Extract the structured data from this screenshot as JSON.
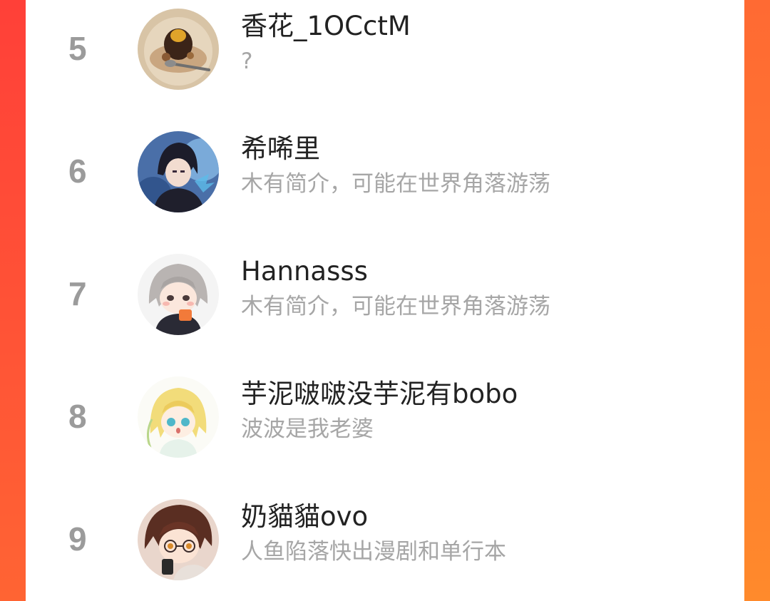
{
  "ranking": {
    "items": [
      {
        "rank": "5",
        "name": "香花_1OCctM",
        "bio": "?",
        "avatar_icon": "dessert-avatar"
      },
      {
        "rank": "6",
        "name": "希唏里",
        "bio": "木有简介，可能在世界角落游荡",
        "avatar_icon": "dark-haired-character-avatar"
      },
      {
        "rank": "7",
        "name": "Hannasss",
        "bio": "木有简介，可能在世界角落游荡",
        "avatar_icon": "chibi-silver-haired-avatar"
      },
      {
        "rank": "8",
        "name": "芋泥啵啵没芋泥有bobo",
        "bio": "波波是我老婆",
        "avatar_icon": "chibi-blonde-avatar"
      },
      {
        "rank": "9",
        "name": "奶貓貓ovo",
        "bio": "人鱼陷落快出漫剧和单行本",
        "avatar_icon": "brown-haired-glasses-avatar"
      }
    ]
  },
  "colors": {
    "accent_left": "#ff4038",
    "accent_right": "#ff8a2c",
    "rank_number": "#9b9b9b",
    "name_text": "#222222",
    "bio_text": "#a6a6a6"
  }
}
